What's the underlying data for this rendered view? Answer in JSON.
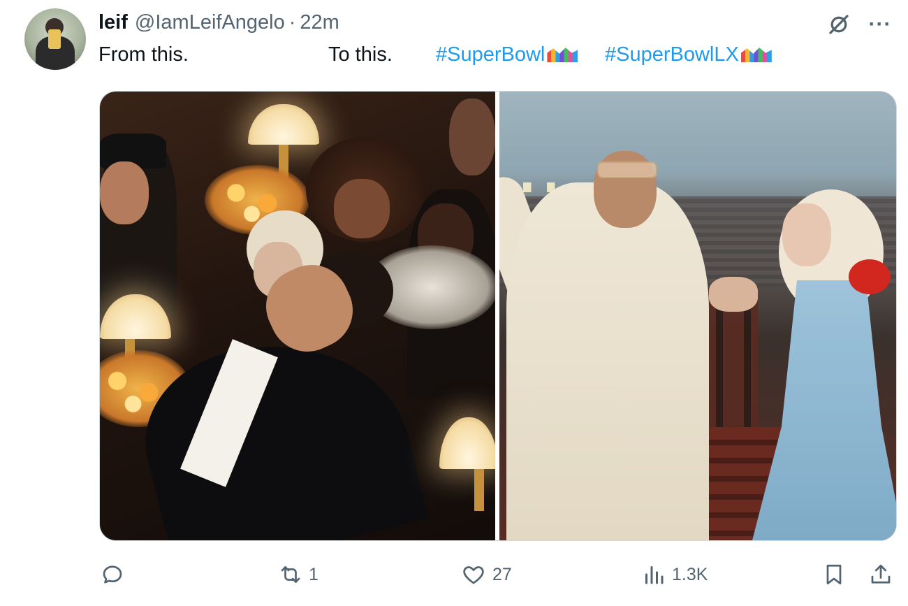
{
  "tweet": {
    "display_name": "leif",
    "handle": "@IamLeifAngelo",
    "separator": "·",
    "time": "22m",
    "text_part1": "From this.",
    "text_part2": "To this.",
    "hashtag1": "#SuperBowl",
    "hashtag2": "#SuperBowlLX"
  },
  "header_icons": {
    "grok": "grok-icon",
    "more": "···"
  },
  "actions": {
    "reply_count": "",
    "retweet_count": "1",
    "like_count": "27",
    "views_count": "1.3K"
  },
  "colors": {
    "accent": "#1d9bf0",
    "muted": "#536471",
    "text": "#0f1419"
  }
}
